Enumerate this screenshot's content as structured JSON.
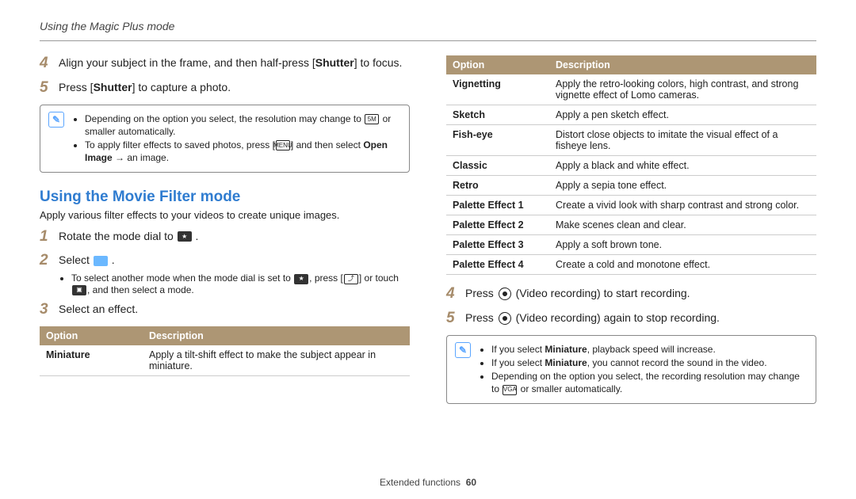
{
  "header": {
    "title": "Using the Magic Plus mode"
  },
  "left": {
    "steps": [
      {
        "num": "4",
        "pre": "Align your subject in the frame, and then half-press [",
        "bold": "Shutter",
        "post": "] to focus."
      },
      {
        "num": "5",
        "pre": "Press [",
        "bold": "Shutter",
        "post": "] to capture a photo."
      }
    ],
    "note": {
      "b1a": "Depending on the option you select, the resolution may change to ",
      "b1_icon": "5M",
      "b1b": " or smaller automatically.",
      "b2a": "To apply filter effects to saved photos, press [",
      "b2_icon": "MENU",
      "b2b": "] and then select ",
      "b2_bold": "Open Image",
      "b2c": " → an image."
    },
    "section_title": "Using the Movie Filter mode",
    "section_desc": "Apply various filter effects to your videos to create unique images.",
    "steps2": [
      {
        "num": "1",
        "text": "Rotate the mode dial to "
      },
      {
        "num": "2",
        "text": "Select "
      }
    ],
    "substep": {
      "a": "To select another mode when the mode dial is set to ",
      "b": ", press [",
      "c": "] or touch ",
      "d": ", and then select a mode."
    },
    "step3": {
      "num": "3",
      "text": "Select an effect."
    },
    "table_hdr": {
      "opt": "Option",
      "desc": "Description"
    },
    "table_rows": [
      {
        "opt": "Miniature",
        "desc": "Apply a tilt-shift effect to make the subject appear in miniature."
      }
    ]
  },
  "right": {
    "table_hdr": {
      "opt": "Option",
      "desc": "Description"
    },
    "table_rows": [
      {
        "opt": "Vignetting",
        "desc": "Apply the retro-looking colors, high contrast, and strong vignette effect of Lomo cameras."
      },
      {
        "opt": "Sketch",
        "desc": "Apply a pen sketch effect."
      },
      {
        "opt": "Fish-eye",
        "desc": "Distort close objects to imitate the visual effect of a fisheye lens."
      },
      {
        "opt": "Classic",
        "desc": "Apply a black and white effect."
      },
      {
        "opt": "Retro",
        "desc": "Apply a sepia tone effect."
      },
      {
        "opt": "Palette Effect 1",
        "desc": "Create a vivid look with sharp contrast and strong color."
      },
      {
        "opt": "Palette Effect 2",
        "desc": "Make scenes clean and clear."
      },
      {
        "opt": "Palette Effect 3",
        "desc": "Apply a soft brown tone."
      },
      {
        "opt": "Palette Effect 4",
        "desc": "Create a cold and monotone effect."
      }
    ],
    "steps": [
      {
        "num": "4",
        "pre": "Press ",
        "post": " (Video recording) to start recording."
      },
      {
        "num": "5",
        "pre": "Press ",
        "post": " (Video recording) again to stop recording."
      }
    ],
    "note": {
      "b1a": "If you select ",
      "b1_bold": "Miniature",
      "b1b": ", playback speed will increase.",
      "b2a": "If you select ",
      "b2_bold": "Miniature",
      "b2b": ", you cannot record the sound in the video.",
      "b3a": "Depending on the option you select, the recording resolution may change to ",
      "b3_icon": "VGA",
      "b3b": " or smaller automatically."
    }
  },
  "footer": {
    "section": "Extended functions",
    "page": "60"
  }
}
